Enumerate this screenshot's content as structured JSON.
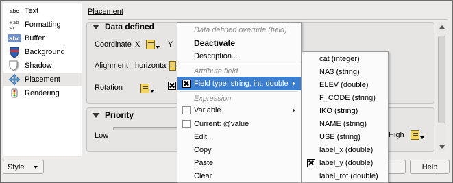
{
  "sidebar": {
    "items": [
      {
        "label": "Text",
        "icon": "abc-text-icon"
      },
      {
        "label": "Formatting",
        "icon": "formatting-icon"
      },
      {
        "label": "Buffer",
        "icon": "buffer-icon"
      },
      {
        "label": "Background",
        "icon": "background-shield-icon"
      },
      {
        "label": "Shadow",
        "icon": "shadow-icon"
      },
      {
        "label": "Placement",
        "icon": "placement-icon",
        "selected": true
      },
      {
        "label": "Rendering",
        "icon": "rendering-icon"
      }
    ]
  },
  "panel": {
    "title": "Placement",
    "data_defined": {
      "header": "Data defined",
      "coordinate_label": "Coordinate",
      "x_label": "X",
      "y_label": "Y",
      "alignment_label": "Alignment",
      "alignment_value": "horizontal",
      "rotation_label": "Rotation"
    },
    "priority": {
      "header": "Priority",
      "low_label": "Low",
      "high_label": "High"
    }
  },
  "bottom": {
    "style_label": "Style",
    "help_label": "Help"
  },
  "context_menu": {
    "header1": "Data defined override (field)",
    "deactivate": "Deactivate",
    "description": "Description...",
    "header2": "Attribute field",
    "field_type": "Field type: string, int, double",
    "header3": "Expression",
    "variable": "Variable",
    "current": "Current: @value",
    "edit": "Edit...",
    "copy": "Copy",
    "paste": "Paste",
    "clear": "Clear"
  },
  "field_menu": {
    "fields": [
      {
        "label": "cat   (integer)",
        "checked": false
      },
      {
        "label": "NA3   (string)",
        "checked": false
      },
      {
        "label": "ELEV   (double)",
        "checked": false
      },
      {
        "label": "F_CODE   (string)",
        "checked": false
      },
      {
        "label": "IKO   (string)",
        "checked": false
      },
      {
        "label": "NAME   (string)",
        "checked": false
      },
      {
        "label": "USE   (string)",
        "checked": false
      },
      {
        "label": "label_x   (double)",
        "checked": false
      },
      {
        "label": "label_y   (double)",
        "checked": true
      },
      {
        "label": "label_rot   (double)",
        "checked": false
      }
    ]
  },
  "colors": {
    "highlight": "#3c7fd1",
    "background": "#ecebe9",
    "icon_yellow": "#f4d35e"
  }
}
